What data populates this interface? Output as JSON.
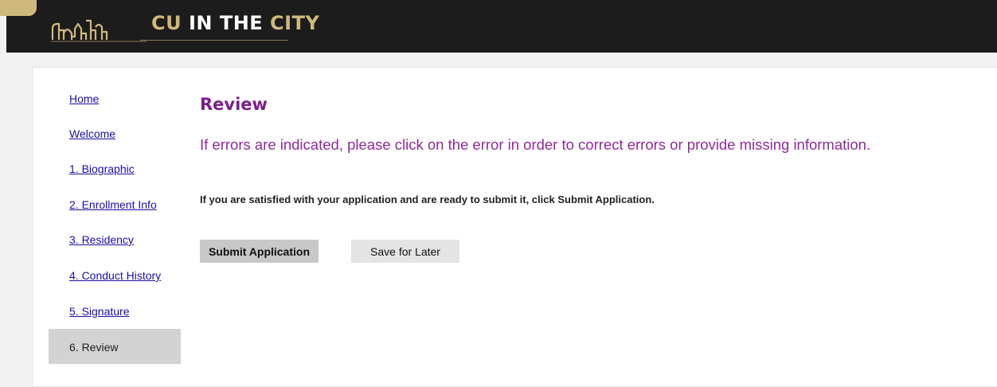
{
  "header": {
    "brand_part1": "CU",
    "brand_part2": " IN THE ",
    "brand_part3": "CITY",
    "accent_color": "#cfb87c",
    "background_color": "#1c1c1c",
    "logo_icon": "skyline-icon"
  },
  "sidebar": {
    "items": [
      {
        "label": "Home"
      },
      {
        "label": "Welcome"
      },
      {
        "label": "1. Biographic"
      },
      {
        "label": "2. Enrollment Info"
      },
      {
        "label": "3. Residency"
      },
      {
        "label": "4. Conduct History"
      },
      {
        "label": "5. Signature"
      }
    ],
    "current": {
      "label": "6. Review"
    },
    "link_color": "#1a0dab"
  },
  "main": {
    "title": "Review",
    "error_message": "If errors are indicated, please click on the error in order to correct errors or provide missing information.",
    "instructions": "If you are satisfied with your application and are ready to submit it, click Submit Application.",
    "submit_label": "Submit Application",
    "save_label": "Save for Later",
    "title_color": "#7b1d8c"
  }
}
